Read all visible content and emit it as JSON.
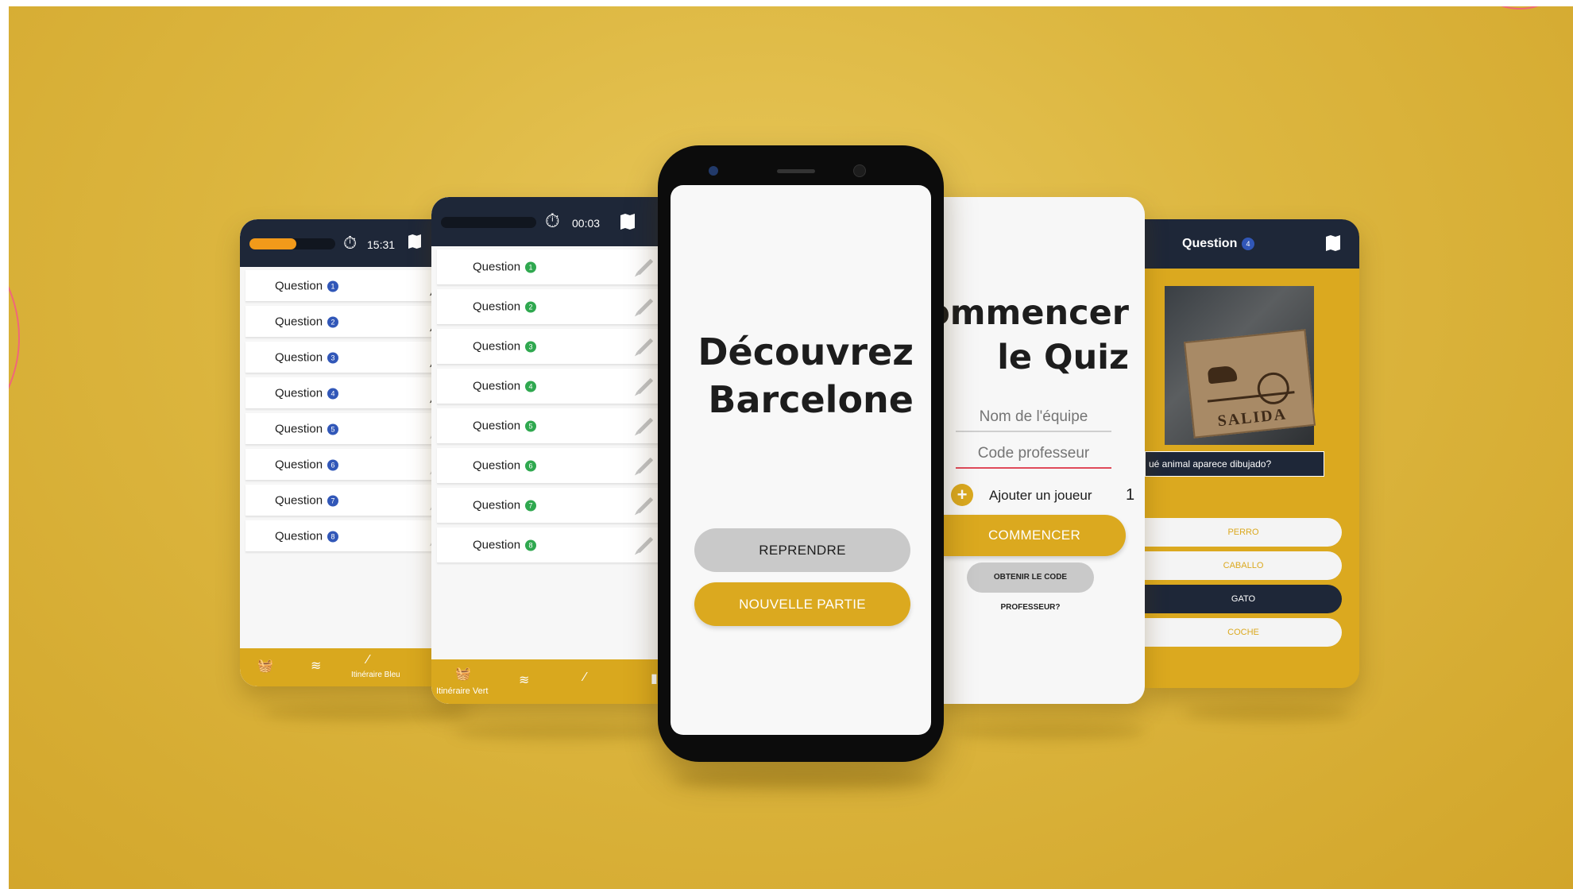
{
  "screen1": {
    "timer": "15:31",
    "progress_percent": 55,
    "rows": [
      {
        "label": "Question",
        "num": "1"
      },
      {
        "label": "Question",
        "num": "2"
      },
      {
        "label": "Question",
        "num": "3"
      },
      {
        "label": "Question",
        "num": "4"
      },
      {
        "label": "Question",
        "num": "5"
      },
      {
        "label": "Question",
        "num": "6"
      },
      {
        "label": "Question",
        "num": "7"
      },
      {
        "label": "Question",
        "num": "8"
      }
    ],
    "footer_caption": "Itinéraire Bleu"
  },
  "screen2": {
    "timer": "00:03",
    "progress_percent": 0,
    "rows": [
      {
        "label": "Question",
        "num": "1"
      },
      {
        "label": "Question",
        "num": "2"
      },
      {
        "label": "Question",
        "num": "3"
      },
      {
        "label": "Question",
        "num": "4"
      },
      {
        "label": "Question",
        "num": "5"
      },
      {
        "label": "Question",
        "num": "6"
      },
      {
        "label": "Question",
        "num": "7"
      },
      {
        "label": "Question",
        "num": "8"
      }
    ],
    "footer_caption": "Itinéraire Vert"
  },
  "phone": {
    "title_line1": "Découvrez",
    "title_line2": "Barcelone",
    "resume_button": "REPRENDRE",
    "new_game_button": "NOUVELLE PARTIE"
  },
  "screen4": {
    "title_line1": "Commencer",
    "title_line2": "le Quiz",
    "team_placeholder": "Nom de l'équipe",
    "code_placeholder": "Code professeur",
    "add_player_label": "Ajouter un joueur",
    "player_count": "1",
    "start_button": "COMMENCER",
    "get_code_button": "OBTENIR LE CODE PROFESSEUR?"
  },
  "screen5": {
    "header_label": "Question",
    "header_num": "4",
    "photo_sign_text": "SALIDA",
    "question_text": "ué animal aparece dibujado?",
    "answers": [
      "PERRO",
      "CABALLO",
      "GATO",
      "COCHE"
    ],
    "selected_answer_index": 2
  },
  "colors": {
    "accent": "#dba91f",
    "navy": "#1e2738",
    "blue_badge": "#3157b8",
    "green_badge": "#2fa84f"
  }
}
